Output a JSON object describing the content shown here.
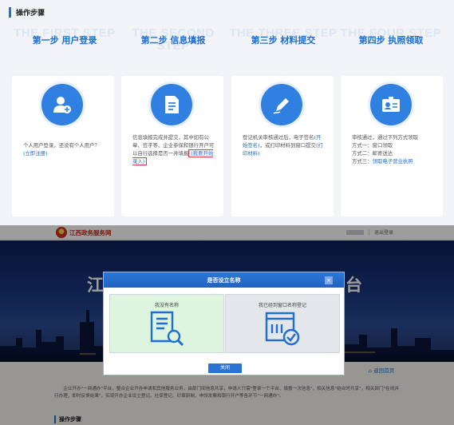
{
  "section_title": "操作步骤",
  "steps": [
    {
      "ghost": "THE FIRST STEP",
      "label": "第一步 用户登录",
      "icon": "user-add-icon"
    },
    {
      "ghost": "THE SECOND STEP",
      "label": "第二步 信息填报",
      "icon": "document-icon"
    },
    {
      "ghost": "THE THREE STEP",
      "label": "第三步 材料提交",
      "icon": "pen-icon"
    },
    {
      "ghost": "THE FOUR STEP",
      "label": "第四步 执照领取",
      "icon": "id-card-icon"
    }
  ],
  "cards": {
    "card1": {
      "text": "个人用户登录，还没有个人用户？",
      "link": "(立即注册)"
    },
    "card2": {
      "text": "信息填报完成并提交，其中如有公章、签字等、企业参保和银行开户可以自行选择是否一并填报",
      "link": "(我要开始录入)"
    },
    "card3": {
      "text": "登记机关审核通过后，电子签名",
      "link1": "(开始签名)",
      "text2": "，或打印材料到窗口提交",
      "link2": "(打印材料)"
    },
    "card4": {
      "line1": "审核通过，通过下列方式领取",
      "line2": "方式一：窗口领取",
      "line3": "方式二：邮寄送达",
      "line4_prefix": "方式三：",
      "line4_link": "领取电子营业执照"
    }
  },
  "site": {
    "name": "江西政务服务网",
    "banner_title": "江西省企业登记网络服务平台",
    "header_logout": "退出登录",
    "home_link": "返回首页",
    "intro": "企业开办\"一网通办\"平台，整合企业开办申请和其他服务业务，由部门间信息共享，申请人只需\"登录一个平台、填报一次信息\"，相关信息\"结合时共享\"，相关部门\"在线并行办理，即时反馈结果\"，实现开办企业设立登记、社保登记、印章刻制、申领发票和银行开户等各环节\"一网通办\"。",
    "bottom_section_title": "操作步骤"
  },
  "modal": {
    "title": "是否设立名称",
    "close_label": "×",
    "option_a": {
      "label": "我没有名称",
      "icon": "list-search-icon"
    },
    "option_b": {
      "label": "我已经到窗口名称登记",
      "icon": "approved-form-icon"
    },
    "close_button": "关闭"
  },
  "colors": {
    "accent": "#1d6fd1",
    "icon_bg": "#2f80e1",
    "option_a_bg": "#ddf5de",
    "highlight_border": "#e23838"
  }
}
